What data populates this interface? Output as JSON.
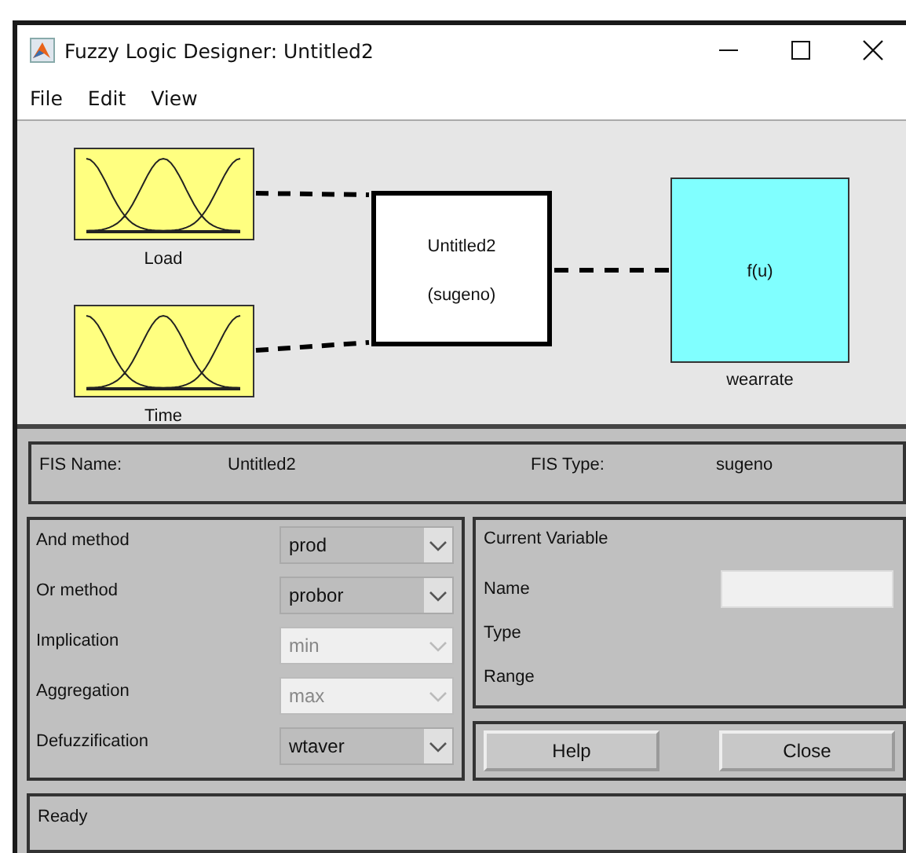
{
  "window": {
    "title": "Fuzzy Logic Designer: Untitled2"
  },
  "menu": [
    "File",
    "Edit",
    "View"
  ],
  "diagram": {
    "inputs": [
      {
        "name": "Load"
      },
      {
        "name": "Time"
      }
    ],
    "system": {
      "name": "Untitled2",
      "type": "(sugeno)"
    },
    "output": {
      "name": "wearrate",
      "function": "f(u)"
    }
  },
  "fis": {
    "name_label": "FIS Name:",
    "name": "Untitled2",
    "type_label": "FIS Type:",
    "type": "sugeno"
  },
  "methods": [
    {
      "label": "And method",
      "value": "prod",
      "disabled": false
    },
    {
      "label": "Or method",
      "value": "probor",
      "disabled": false
    },
    {
      "label": "Implication",
      "value": "min",
      "disabled": true
    },
    {
      "label": "Aggregation",
      "value": "max",
      "disabled": true
    },
    {
      "label": "Defuzzification",
      "value": "wtaver",
      "disabled": false
    }
  ],
  "current_variable": {
    "title": "Current Variable",
    "labels": [
      "Name",
      "Type",
      "Range"
    ]
  },
  "buttons": [
    "Help",
    "Close"
  ],
  "status_bar": "Ready"
}
